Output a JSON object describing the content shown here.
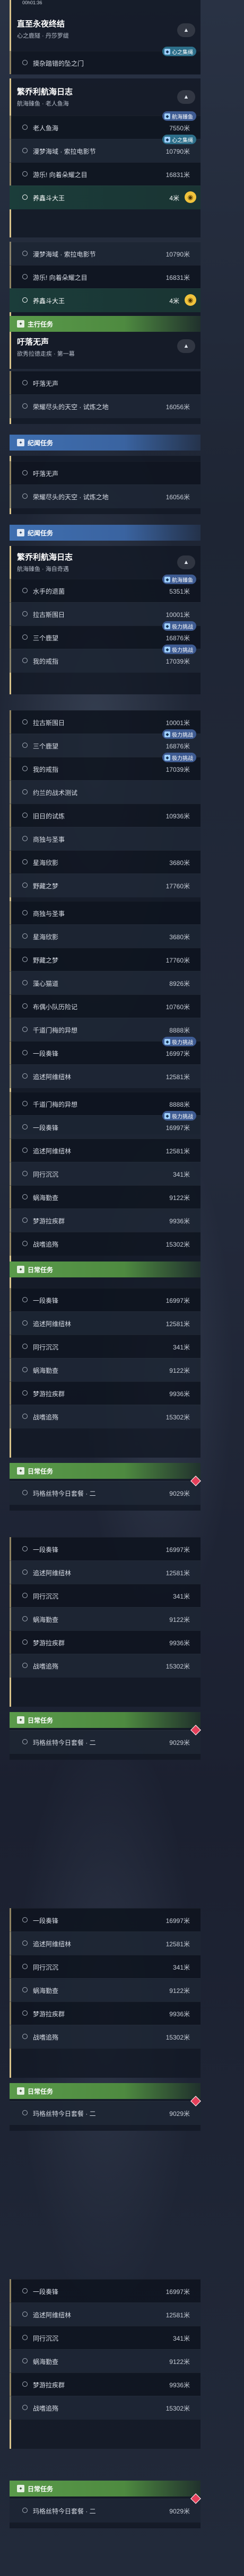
{
  "header": {
    "timer": "00h01:36",
    "title": "直至永夜终结",
    "subtitle": "心之鹿隧 · 丹莎罗缇",
    "collapse_icon": "chevron-up"
  },
  "first_row": {
    "label": "摸杂踏错的坠之门"
  },
  "quest_journal": {
    "title": "繁乔利航海日志",
    "subtitle": "航海臻鱼 · 老人鱼海"
  },
  "quest_journal_2": {
    "title": "繁乔利航海日志",
    "subtitle": "航海臻鱼 · 海自奇遇"
  },
  "quest_fallen": {
    "title": "吁落无声",
    "subtitle": "欲秀拉德走疾 · 第一幕"
  },
  "badges": {
    "heart_ship": "心之集绳",
    "voyage_log": "航海臻鱼",
    "extreme_chal": "极力挑战"
  },
  "ribbons": {
    "main": "主行任务",
    "explore": "纪闻任务",
    "daily": "日常任务"
  },
  "rows": {
    "r1": {
      "label": "老人鱼海",
      "dist": "7550米"
    },
    "r2": {
      "label": "漫梦海域 · 索拉电影节",
      "dist": "10790米"
    },
    "r3": {
      "label": "游乐! 向着朵耀之目",
      "dist": "16831米"
    },
    "r4": {
      "label": "养鑫斗大王",
      "dist": "4米"
    },
    "r5": {
      "label": "漫梦海域 · 索拉电影节",
      "dist": "10790米"
    },
    "r6": {
      "label": "游乐! 向着朵耀之目",
      "dist": "16831米"
    },
    "r7": {
      "label": "养鑫斗大王",
      "dist": "4米"
    },
    "r8": {
      "label": "吁落无声",
      "dist": ""
    },
    "r9": {
      "label": "荣耀尽头的天空 · 试炼之地",
      "dist": "16056米"
    },
    "r10": {
      "label": "吁落无声",
      "dist": ""
    },
    "r11": {
      "label": "荣耀尽头的天空 · 试炼之地",
      "dist": "16056米"
    },
    "r12": {
      "label": "水手的退菌",
      "dist": "5351米"
    },
    "r13": {
      "label": "拉古斯围日",
      "dist": "10001米"
    },
    "r14": {
      "label": "三个鹿望",
      "dist": "16876米"
    },
    "r15": {
      "label": "我的戒指",
      "dist": "17039米"
    },
    "r16": {
      "label": "拉古斯围日",
      "dist": "10001米"
    },
    "r17": {
      "label": "三个鹿望",
      "dist": "16876米"
    },
    "r18": {
      "label": "我的戒指",
      "dist": "17039米"
    },
    "r19": {
      "label": "约兰的战术测试",
      "dist": ""
    },
    "r20": {
      "label": "旧日的试炼",
      "dist": "10936米"
    },
    "r21": {
      "label": "商独与圣事",
      "dist": ""
    },
    "r22": {
      "label": "星海欣影",
      "dist": "3680米"
    },
    "r23": {
      "label": "野藏之梦",
      "dist": "17760米"
    },
    "r24": {
      "label": "商独与圣事",
      "dist": ""
    },
    "r25": {
      "label": "星海欣影",
      "dist": "3680米"
    },
    "r26": {
      "label": "野藏之梦",
      "dist": "17760米"
    },
    "r27": {
      "label": "藻心猫道",
      "dist": "8926米"
    },
    "r28": {
      "label": "布偶小队历险记",
      "dist": "10760米"
    },
    "r29": {
      "label": "千道门梅的异想",
      "dist": "8888米"
    },
    "r30": {
      "label": "一段奏锋",
      "dist": "16997米"
    },
    "r31": {
      "label": "追述阿维纽林",
      "dist": "12581米"
    },
    "r32": {
      "label": "千道门梅的异想",
      "dist": "8888米"
    },
    "r33": {
      "label": "一段奏锋",
      "dist": "16997米"
    },
    "r34": {
      "label": "追述阿维纽林",
      "dist": "12581米"
    },
    "r35": {
      "label": "同行沉沉",
      "dist": "341米"
    },
    "r36": {
      "label": "蜗海勤查",
      "dist": "9122米"
    },
    "r37": {
      "label": "梦游拉疾群",
      "dist": "9936米"
    },
    "r38": {
      "label": "战嗜追殇",
      "dist": "15302米"
    },
    "r39": {
      "label": "一段奏锋",
      "dist": "16997米"
    },
    "r40": {
      "label": "追述阿维纽林",
      "dist": "12581米"
    },
    "r41": {
      "label": "同行沉沉",
      "dist": "341米"
    },
    "r42": {
      "label": "蜗海勤查",
      "dist": "9122米"
    },
    "r43": {
      "label": "梦游拉疾群",
      "dist": "9936米"
    },
    "r44": {
      "label": "战嗜追殇",
      "dist": "15302米"
    },
    "r45": {
      "label": "玛格丝特今日套餐 · 二",
      "dist": "9029米"
    },
    "r46": {
      "label": "一段奏锋",
      "dist": "16997米"
    },
    "r47": {
      "label": "追述阿维纽林",
      "dist": "12581米"
    },
    "r48": {
      "label": "同行沉沉",
      "dist": "341米"
    },
    "r49": {
      "label": "蜗海勤查",
      "dist": "9122米"
    },
    "r50": {
      "label": "梦游拉疾群",
      "dist": "9936米"
    },
    "r51": {
      "label": "战嗜追殇",
      "dist": "15302米"
    },
    "r52": {
      "label": "玛格丝特今日套餐 · 二",
      "dist": "9029米"
    },
    "r53": {
      "label": "一段奏锋",
      "dist": "16997米"
    },
    "r54": {
      "label": "追述阿维纽林",
      "dist": "12581米"
    },
    "r55": {
      "label": "同行沉沉",
      "dist": "341米"
    },
    "r56": {
      "label": "蜗海勤查",
      "dist": "9122米"
    },
    "r57": {
      "label": "梦游拉疾群",
      "dist": "9936米"
    },
    "r58": {
      "label": "战嗜追殇",
      "dist": "15302米"
    },
    "r59": {
      "label": "玛格丝特今日套餐 · 二",
      "dist": "9029米"
    }
  },
  "colors": {
    "accent": "#d9c38a",
    "highlight": "#1b3d3a",
    "main_ribbon": "#5a9a4a",
    "explore_ribbon": "#3f6fb0",
    "daily_ribbon": "#5a9a4a",
    "badge": "#3e5b92",
    "map_marker": "#f0c33c"
  }
}
